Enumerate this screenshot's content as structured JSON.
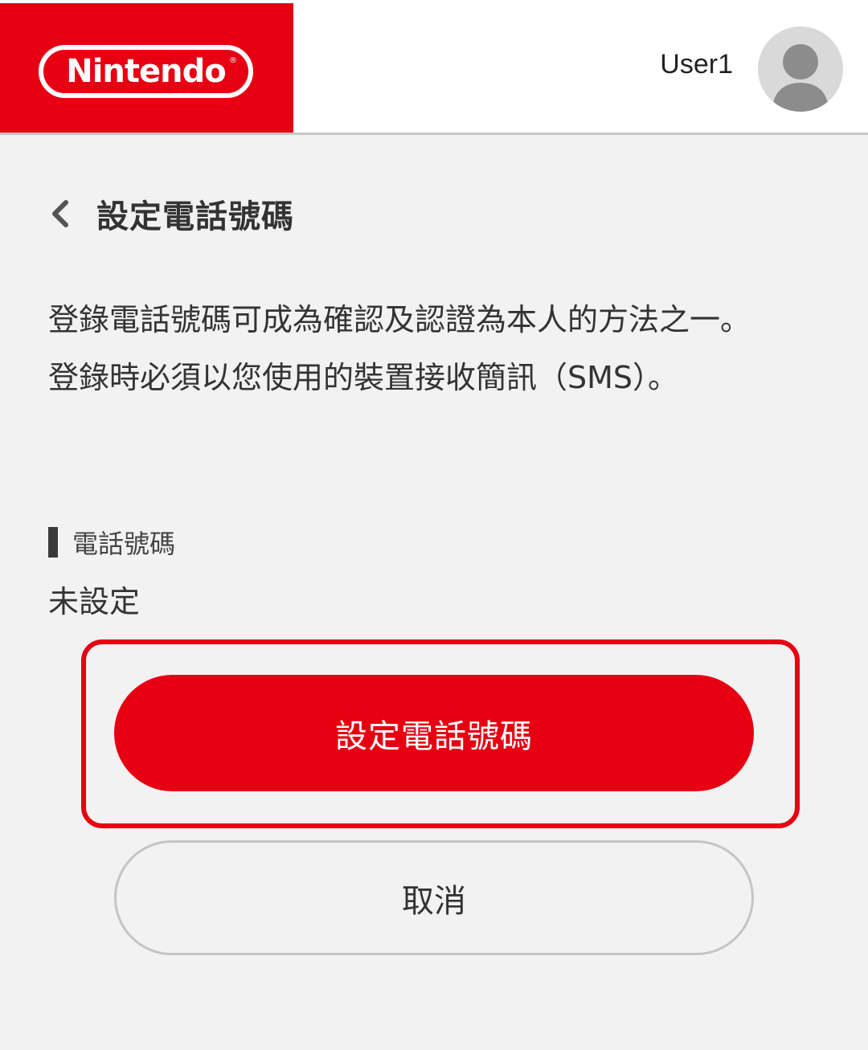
{
  "header": {
    "logo_text": "Nintendo",
    "logo_reg_mark": "®",
    "user_name": "User1",
    "avatar_icon": "user-silhouette-icon",
    "brand_color": "#e60012"
  },
  "page": {
    "back_icon": "chevron-left-icon",
    "title": "設定電話號碼",
    "description_line1": "登錄電話號碼可成為確認及認證為本人的方法之一。",
    "description_line2": "登錄時必須以您使用的裝置接收簡訊（SMS）。"
  },
  "phone_section": {
    "label": "電話號碼",
    "value": "未設定"
  },
  "actions": {
    "primary_label": "設定電話號碼",
    "cancel_label": "取消"
  }
}
